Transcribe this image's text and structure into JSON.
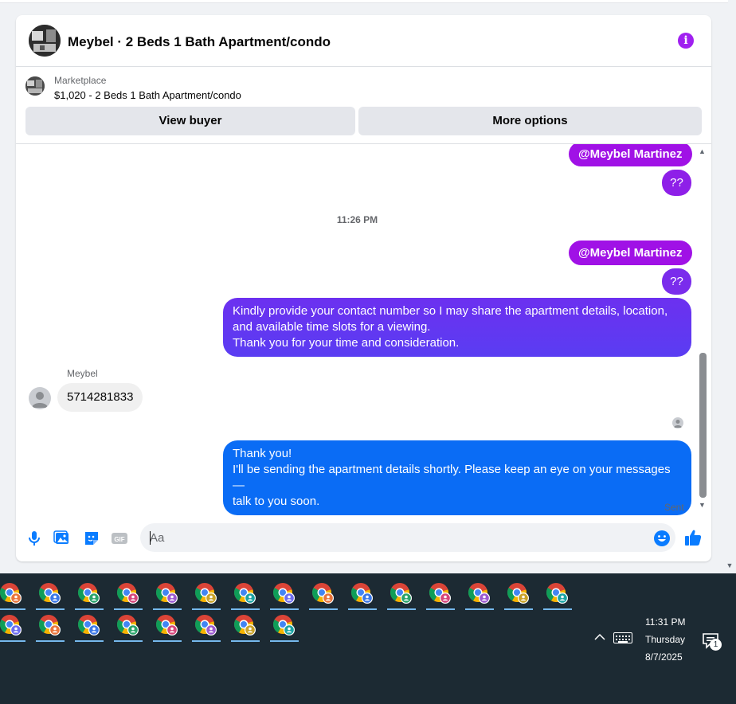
{
  "chat": {
    "title": "Meybel · 2 Beds 1 Bath Apartment/condo",
    "info_icon": "info-icon"
  },
  "listing": {
    "source": "Marketplace",
    "title": "$1,020 - 2 Beds 1 Bath Apartment/condo",
    "view_buyer_label": "View buyer",
    "more_options_label": "More options"
  },
  "messages": {
    "mention_1": "@Meybel Martinez",
    "qq_1": "??",
    "timestamp": "11:26 PM",
    "mention_2": "@Meybel Martinez",
    "qq_2": "??",
    "long_line_1": "Kindly provide your contact number so I may share the apartment details, location,",
    "long_line_2": "and available time slots for a viewing.",
    "long_line_3": "Thank you for your time and consideration.",
    "sender_name": "Meybel",
    "received": "5714281833",
    "reply_line_1": "Thank you!",
    "reply_line_2": "I'll be sending the apartment details shortly. Please keep an eye on your messages—",
    "reply_line_3": "talk to you soon.",
    "status": "Sent"
  },
  "composer": {
    "placeholder": "Aa",
    "gif_label": "GIF"
  },
  "taskbar": {
    "time": "11:31 PM",
    "day": "Thursday",
    "date": "8/7/2025",
    "notification_count": "1"
  },
  "colors": {
    "mention_bubble": "#a011e6",
    "purple_bubble": "#8e1fe8",
    "blue_bubble": "#0a6cf5",
    "messenger_blue": "#0a7cff",
    "taskbar_bg": "#1c2a33"
  }
}
